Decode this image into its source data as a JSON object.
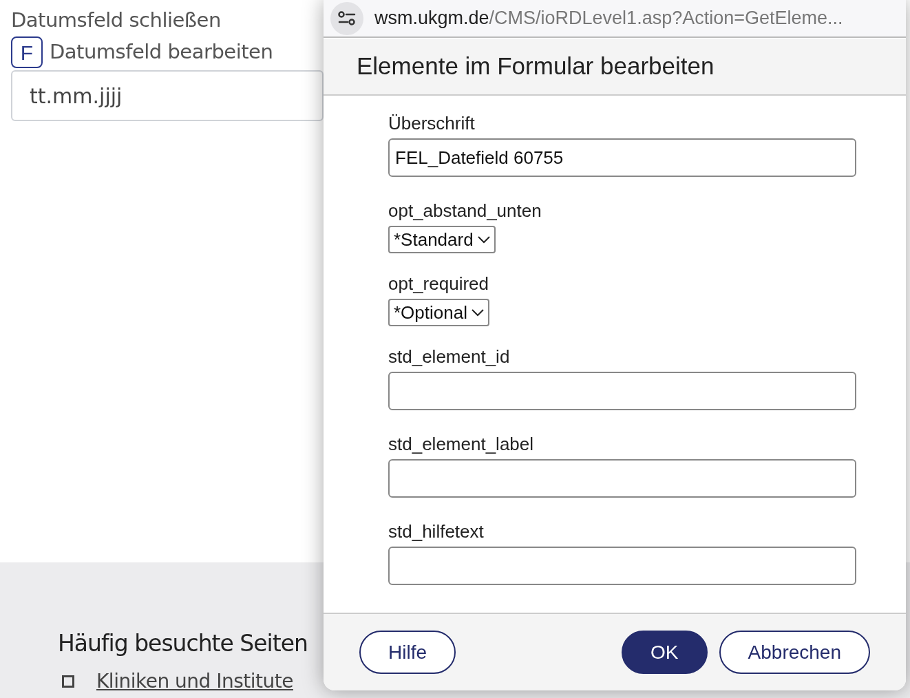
{
  "background": {
    "close_link": "Datumsfeld schließen",
    "edit_link": {
      "badge": "F",
      "label": "Datumsfeld bearbeiten"
    },
    "date_field": {
      "placeholder": "tt.mm.jjjj"
    },
    "footer": {
      "heading": "Häufig besuchte Seiten",
      "links": [
        "Kliniken und Institute"
      ]
    }
  },
  "url_bar": {
    "domain": "wsm.ukgm.de",
    "path": "/CMS/ioRDLevel1.asp?Action=GetEleme..."
  },
  "dialog": {
    "title": "Elemente im Formular bearbeiten",
    "fields": [
      {
        "kind": "text",
        "label": "Überschrift",
        "value": "FEL_Datefield 60755"
      },
      {
        "kind": "select",
        "label": "opt_abstand_unten",
        "value": "*Standard"
      },
      {
        "kind": "select",
        "label": "opt_required",
        "value": "*Optional"
      },
      {
        "kind": "text",
        "label": "std_element_id"
      },
      {
        "kind": "text",
        "label": "std_element_label"
      },
      {
        "kind": "text",
        "label": "std_hilfetext"
      }
    ],
    "buttons": [
      {
        "label": "Hilfe",
        "kind": "secondary"
      },
      {
        "label": "OK",
        "kind": "primary"
      },
      {
        "label": "Abbrechen",
        "kind": "secondary"
      }
    ]
  }
}
